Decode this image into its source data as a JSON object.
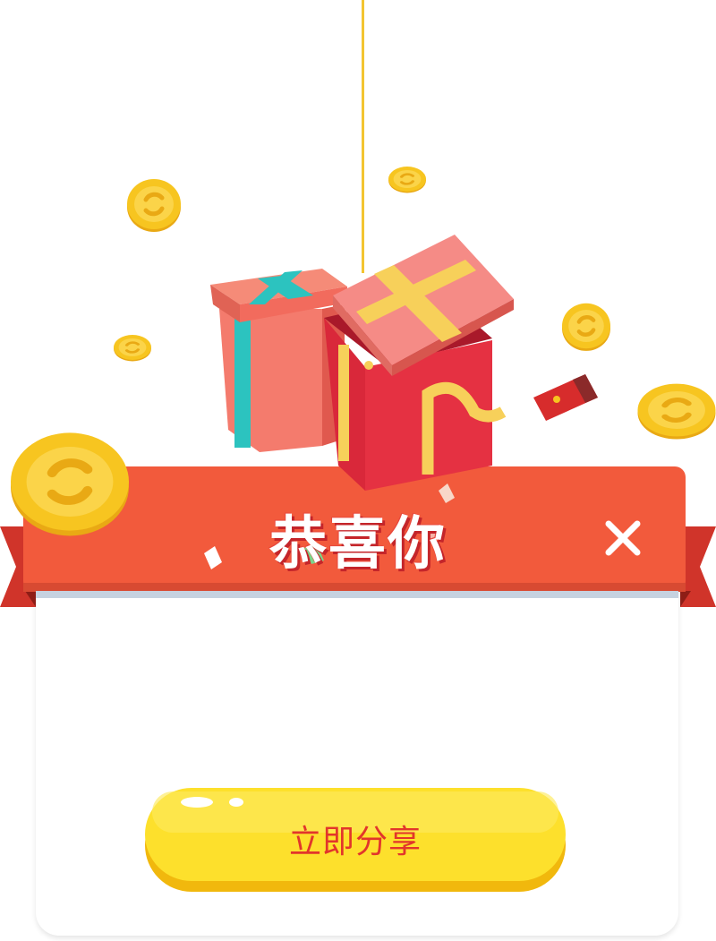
{
  "dialog": {
    "title": "恭喜你",
    "close_symbol": "✕"
  },
  "actions": {
    "share_label": "立即分享"
  },
  "icons": {
    "close": "close-icon",
    "gift_box_left": "gift-box-icon",
    "gift_box_open": "open-gift-box-icon",
    "coin": "gold-coin-icon",
    "red_envelope": "red-envelope-icon"
  },
  "colors": {
    "banner_red": "#f25a3c",
    "banner_dark_red": "#c62c26",
    "button_yellow": "#fde02c",
    "button_shadow": "#f1b80d",
    "button_text": "#e2352b",
    "coin_gold": "#f7c520"
  }
}
